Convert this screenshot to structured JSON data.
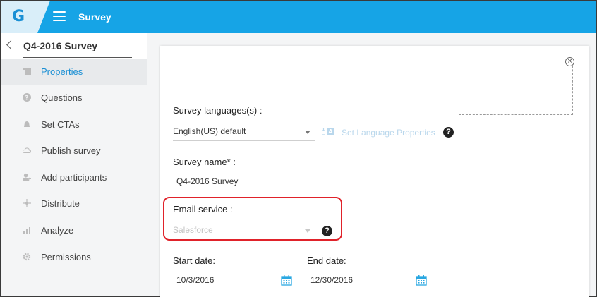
{
  "header": {
    "logo_letter": "G",
    "app_title": "Survey",
    "bar_color": "#16a4e6"
  },
  "sidebar": {
    "survey_title": "Q4-2016 Survey",
    "items": [
      {
        "label": "Properties",
        "icon": "properties-icon",
        "active": true
      },
      {
        "label": "Questions",
        "icon": "question-circle-icon",
        "active": false
      },
      {
        "label": "Set CTAs",
        "icon": "bell-icon",
        "active": false
      },
      {
        "label": "Publish survey",
        "icon": "cloud-icon",
        "active": false
      },
      {
        "label": "Add participants",
        "icon": "add-user-icon",
        "active": false
      },
      {
        "label": "Distribute",
        "icon": "distribute-icon",
        "active": false
      },
      {
        "label": "Analyze",
        "icon": "bar-chart-icon",
        "active": false
      },
      {
        "label": "Permissions",
        "icon": "gear-icon",
        "active": false
      }
    ]
  },
  "form": {
    "languages_label": "Survey languages(s) :",
    "language_value": "English(US) default",
    "set_language_properties": "Set Language Properties",
    "survey_name_label": "Survey name* :",
    "survey_name_value": "Q4-2016 Survey",
    "email_service_label": "Email service :",
    "email_service_value": "Salesforce",
    "start_date_label": "Start date:",
    "start_date_value": "10/3/2016",
    "end_date_label": "End date:",
    "end_date_value": "12/30/2016",
    "help_glyph": "?",
    "close_glyph": "×"
  },
  "colors": {
    "accent": "#1a8fd4",
    "highlight_border": "#e0222a"
  }
}
